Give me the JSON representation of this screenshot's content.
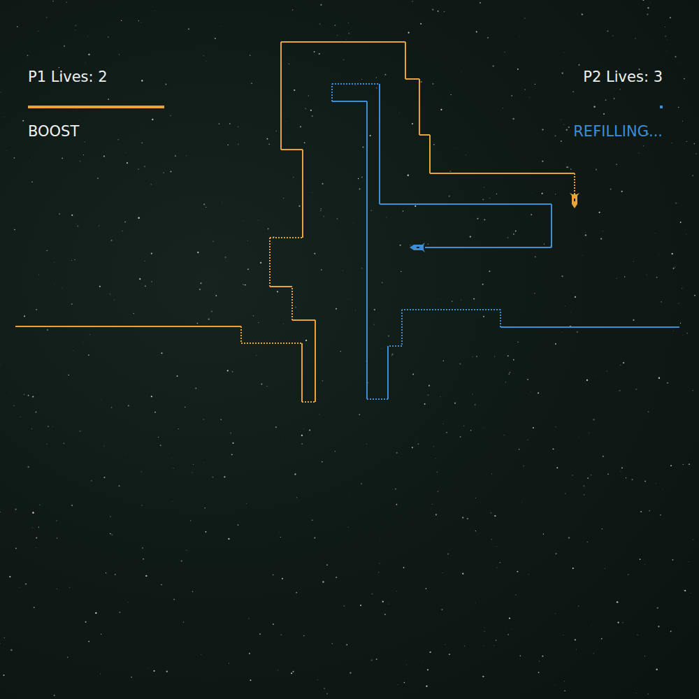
{
  "players": [
    {
      "name": "P1",
      "lives_label": "P1 Lives: 2",
      "status": "BOOST",
      "boost_ready": true,
      "level": 1.0,
      "color": "#e8a33a"
    },
    {
      "name": "P2",
      "lives_label": "P2 Lives: 3",
      "status": "REFILLING...",
      "boost_ready": false,
      "level": 0.02,
      "color": "#3a8fd8"
    }
  ]
}
